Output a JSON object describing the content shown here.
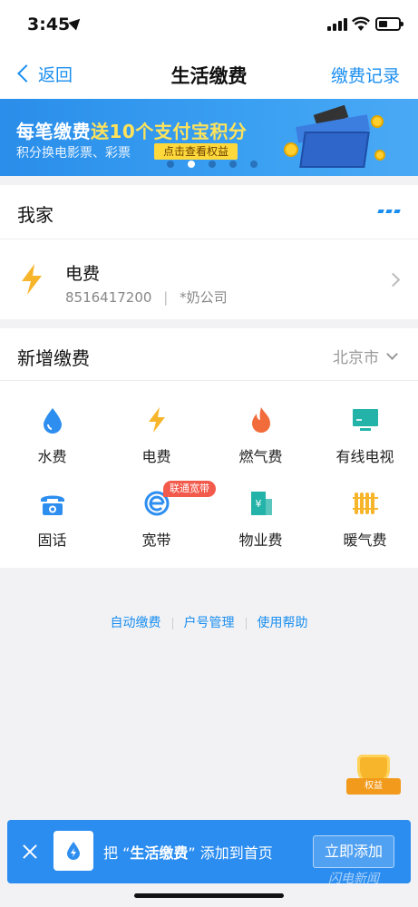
{
  "status_bar": {
    "time": "3:45"
  },
  "nav": {
    "back_label": "返回",
    "title": "生活缴费",
    "right_label": "缴费记录"
  },
  "banner": {
    "title_prefix": "每笔缴费",
    "title_highlight": "送10个支付宝积分",
    "subtitle": "积分换电影票、彩票",
    "cta": "点击查看权益",
    "dots_total": 5,
    "active_dot": 1
  },
  "home": {
    "title": "我家",
    "bills": [
      {
        "icon": "lightning-icon",
        "name": "电费",
        "account": "8516417200",
        "company": "*奶公司",
        "meta": "8516417200  |  *奶公司"
      }
    ]
  },
  "new_payment": {
    "title": "新增缴费",
    "city": "北京市",
    "items": [
      {
        "label": "水费",
        "icon": "water-drop-icon",
        "color": "#2e8ef0"
      },
      {
        "label": "电费",
        "icon": "lightning-icon",
        "color": "#f7b52b"
      },
      {
        "label": "燃气费",
        "icon": "flame-icon",
        "color": "#f26b3a"
      },
      {
        "label": "有线电视",
        "icon": "tv-icon",
        "color": "#23b3a8"
      },
      {
        "label": "固话",
        "icon": "telephone-icon",
        "color": "#2e8ef0"
      },
      {
        "label": "宽带",
        "icon": "broadband-e-icon",
        "color": "#2e8ef0",
        "badge": "联通宽带"
      },
      {
        "label": "物业费",
        "icon": "building-icon",
        "color": "#23b3a8"
      },
      {
        "label": "暖气费",
        "icon": "radiator-icon",
        "color": "#f7b52b"
      }
    ]
  },
  "links": {
    "auto_pay": "自动缴费",
    "account_manage": "户号管理",
    "help": "使用帮助"
  },
  "float_badge": {
    "label": "权益"
  },
  "add_bar": {
    "text_prefix": "把 “",
    "text_app": "生活缴费",
    "text_suffix": "” 添加到首页",
    "button": "立即添加"
  },
  "watermark": "闪电新闻",
  "colors": {
    "accent": "#1a8ef0",
    "banner_start": "#2a8eea",
    "highlight": "#ffe35a",
    "badge_red": "#f25a4c"
  }
}
